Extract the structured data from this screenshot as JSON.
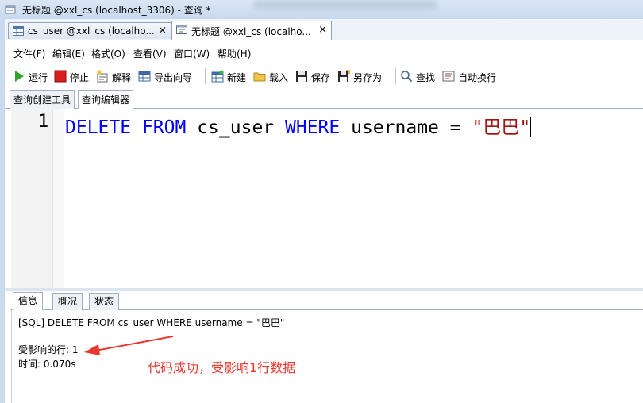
{
  "window": {
    "title": "无标题 @xxl_cs (localhost_3306) - 查询 *"
  },
  "document_tabs": [
    {
      "label": "cs_user @xxl_cs (localho...",
      "close": "×",
      "icon": "table-icon"
    },
    {
      "label": "无标题 @xxl_cs (localho...",
      "close": "×",
      "icon": "query-icon"
    }
  ],
  "menu": [
    "文件(F)",
    "编辑(E)",
    "格式(O)",
    "查看(V)",
    "窗口(W)",
    "帮助(H)"
  ],
  "toolbar": {
    "run": "运行",
    "stop": "停止",
    "explain": "解释",
    "export_wizard": "导出向导",
    "new": "新建",
    "load": "载入",
    "save": "保存",
    "save_as": "另存为",
    "find": "查找",
    "word_wrap": "自动换行"
  },
  "editor_tabs": [
    "查询创建工具",
    "查询编辑器"
  ],
  "editor": {
    "line_number": "1",
    "tokens": {
      "delete": "DELETE",
      "from": "FROM",
      "table": "cs_user",
      "where": "WHERE",
      "column": "username",
      "op": "=",
      "value": "\"巴巴\""
    }
  },
  "result_tabs": [
    "信息",
    "概况",
    "状态"
  ],
  "result": {
    "sql_line": "[SQL] DELETE FROM cs_user WHERE username = \"巴巴\"",
    "affected": "受影响的行: 1",
    "time": "时间: 0.070s"
  },
  "annotation": {
    "text": "代码成功，受影响1行数据",
    "color": "#e8382f"
  },
  "colors": {
    "keyword": "#0000ff",
    "string": "#a31515"
  }
}
